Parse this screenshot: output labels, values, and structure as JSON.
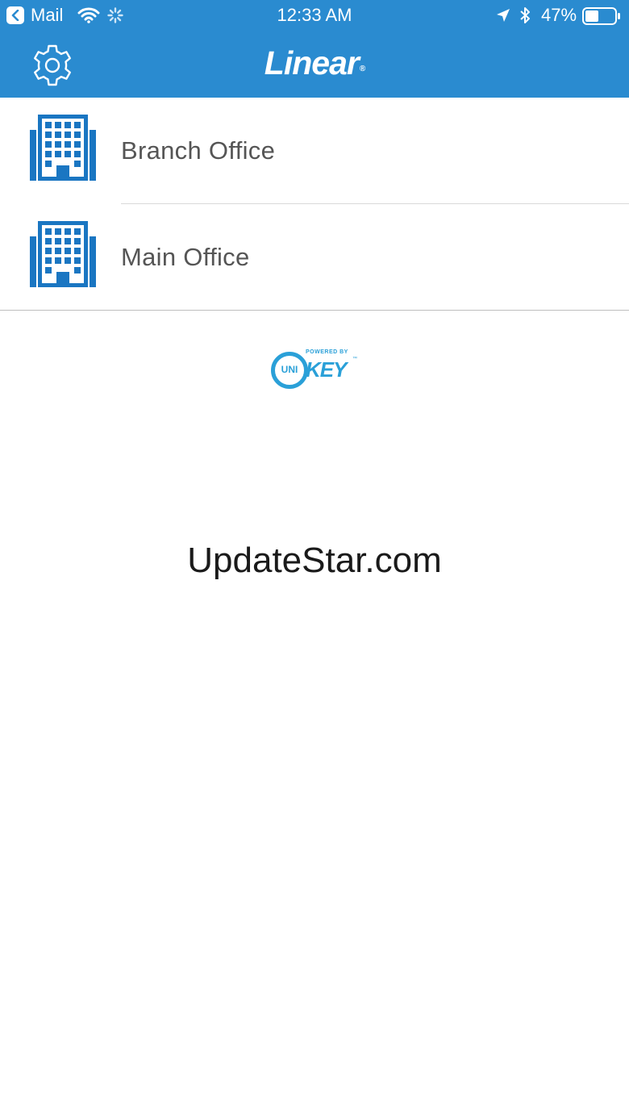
{
  "status_bar": {
    "back_app": "Mail",
    "time": "12:33 AM",
    "battery_percent": "47%",
    "battery_level": 0.47,
    "icons": [
      "back-arrow-icon",
      "wifi-icon",
      "activity-spinner-icon",
      "location-arrow-icon",
      "bluetooth-icon",
      "battery-icon"
    ]
  },
  "header": {
    "brand": "Linear",
    "brand_mark": "®",
    "background": "#2a8bd0",
    "left_icon": "gear-icon"
  },
  "sites": [
    {
      "label": "Branch Office",
      "icon": "office-building-icon"
    },
    {
      "label": "Main Office",
      "icon": "office-building-icon"
    }
  ],
  "powered_by": {
    "small_text": "POWERED BY",
    "ring_text": "UNI",
    "word": "KEY",
    "tm": "™",
    "color": "#2aa0d8"
  },
  "watermark": "UpdateStar.com",
  "colors": {
    "accent": "#2a8bd0",
    "icon_blue": "#1a76c2",
    "label_gray": "#555555"
  }
}
